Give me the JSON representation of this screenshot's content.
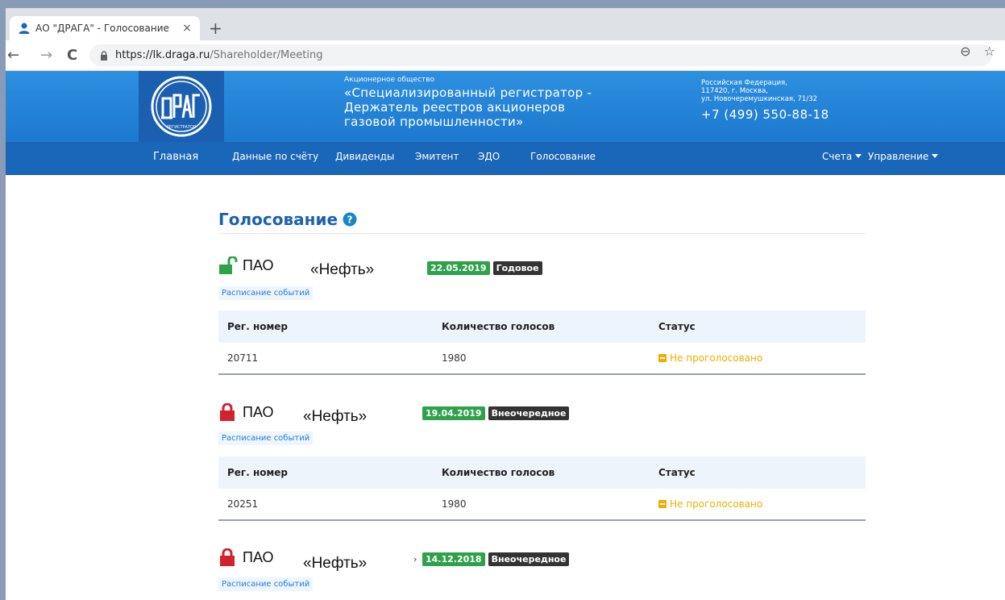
{
  "browser": {
    "tab_title": "АО \"ДРАГА\" - Голосование",
    "tab_close": "×",
    "new_tab": "+",
    "url_host": "https://lk.draga.ru",
    "url_path": "/Shareholder/Meeting",
    "back": "←",
    "forward": "→",
    "reload": "C",
    "zoom": "⊖",
    "star": "☆"
  },
  "header": {
    "org_small": "Акционерное общество",
    "org_name": "«Специализированный регистратор - Держатель реестров акционеров газовой промышленности»",
    "address_1": "Российская Федерация,",
    "address_2": "117420, г. Москва,",
    "address_3": "ул. Новочеремушкинская, 71/32",
    "phone": "+7 (499) 550-88-18",
    "logo_text": "ДРАГА",
    "logo_sub": "РЕГИСТРАТОР"
  },
  "nav": {
    "items": [
      "Главная",
      "Данные по счёту",
      "Дивиденды",
      "Эмитент",
      "ЭДО",
      "Голосование"
    ],
    "right": [
      "Счета",
      "Управление"
    ]
  },
  "page": {
    "title": "Голосование"
  },
  "table_headers": {
    "reg": "Рег. номер",
    "votes": "Количество голосов",
    "status": "Статус"
  },
  "meetings": [
    {
      "issuer": "ПАО",
      "name": "«Нефть»",
      "date": "22.05.2019",
      "type": "Годовое",
      "schedule": "Расписание событий",
      "lock": "open",
      "reg": "20711",
      "votes": "1980",
      "status": "Не проголосовано"
    },
    {
      "issuer": "ПАО",
      "name": "«Нефть»",
      "date": "19.04.2019",
      "type": "Внеочередное",
      "schedule": "Расписание событий",
      "lock": "closed",
      "reg": "20251",
      "votes": "1980",
      "status": "Не проголосовано"
    },
    {
      "issuer": "ПАО",
      "name": "«Нефть»",
      "date": "14.12.2018",
      "type": "Внеочередное",
      "schedule": "Расписание событий",
      "lock": "closed",
      "chevron": "›"
    }
  ],
  "colors": {
    "brand_blue": "#1d79cf",
    "nav_blue": "#1a66b8",
    "title_blue": "#1a62b0",
    "date_green": "#2fa14b",
    "status_amber": "#f0ad00",
    "lock_red": "#d0232f",
    "lock_green": "#2fa14b"
  }
}
